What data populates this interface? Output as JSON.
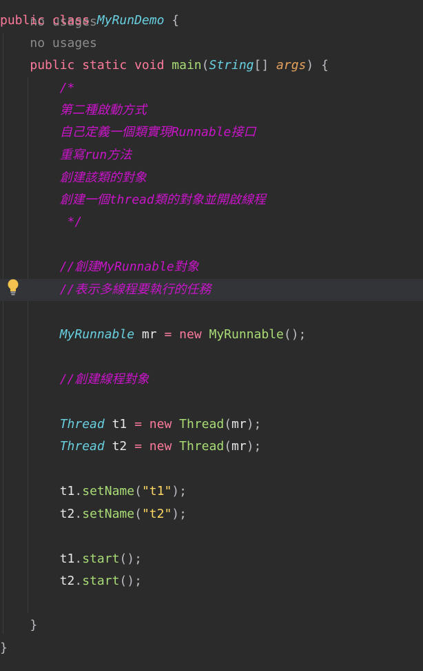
{
  "editor": {
    "top_hint": "no usages",
    "class_kw": "public class",
    "class_name": "MyRunDemo",
    "open_brace": "{",
    "method_hint": "no usages",
    "method_mods": "public static void",
    "method_name": "main",
    "param_open": "(",
    "param_type": "String",
    "param_brackets": "[]",
    "param_name": "args",
    "param_close": ")",
    "comment_block": [
      "/*",
      "第二種啟動方式",
      "自己定義一個類實現Runnable接口",
      "重寫run方法",
      "創建該類的對象",
      "創建一個thread類的對象並開啟線程",
      " */"
    ],
    "comment_create_runnable": "//創建MyRunnable對象",
    "comment_task": "//表示多線程要執行的任務",
    "comment_create_threads": "//創建線程對象",
    "runnable_type": "MyRunnable",
    "runnable_var": "mr",
    "assign": "=",
    "new_kw": "new",
    "runnable_ctor": "MyRunnable",
    "runnable_args": "();",
    "thread_type": "Thread",
    "thread_var_1": "t1",
    "thread_var_2": "t2",
    "thread_ctor": "Thread",
    "thread_args_open": "(",
    "thread_arg": "mr",
    "thread_args_close": ");",
    "setname_method": "setName",
    "setname_arg_1": "\"t1\"",
    "setname_arg_2": "\"t2\"",
    "start_method": "start",
    "dot": ".",
    "paren_open": "(",
    "call_close": ");",
    "empty_call": "();",
    "method_close_brace": "}",
    "class_close_brace": "}"
  },
  "colors": {
    "background": "#2b2b2b",
    "current_line": "#323438",
    "keyword": "#cf8e6d",
    "comment": "#c815c8",
    "class_ref": "#68d0e0",
    "method": "#a9dc76",
    "string": "#ffd866"
  },
  "icons": {
    "gutter": "lightbulb-icon"
  }
}
